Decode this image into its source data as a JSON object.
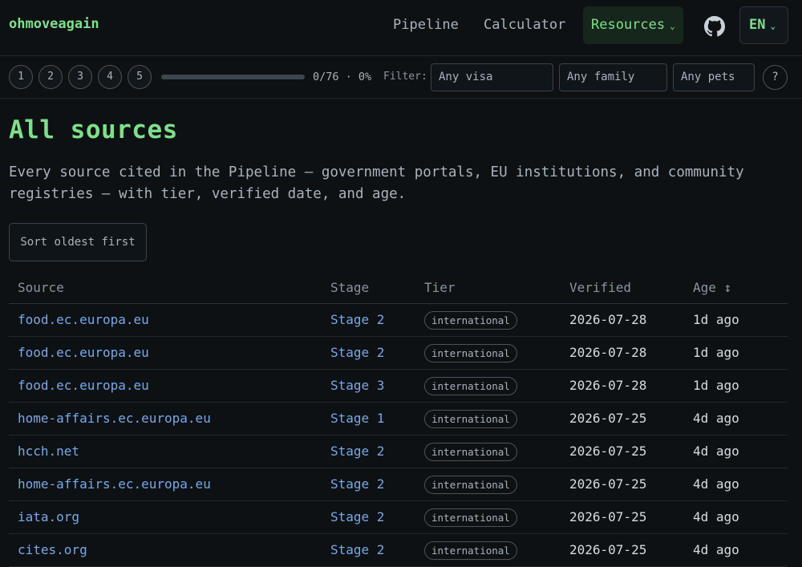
{
  "brand": "ohmoveagain",
  "nav": {
    "pipeline": "Pipeline",
    "calculator": "Calculator",
    "resources": "Resources",
    "caret": "⌄",
    "lang": "EN",
    "github_icon": "github-icon"
  },
  "toolbar": {
    "steps": [
      "1",
      "2",
      "3",
      "4",
      "5"
    ],
    "progress_fraction": 0,
    "progress_text": "0/76 · 0%",
    "filter_label": "Filter:",
    "visa_select": "Any visa",
    "family_select": "Any family",
    "pets_select": "Any pets",
    "help": "?"
  },
  "main": {
    "title": "All sources",
    "description": "Every source cited in the Pipeline — government portals, EU institutions, and community registries — with tier, verified date, and age.",
    "sort_button": "Sort oldest first"
  },
  "table": {
    "headers": {
      "source": "Source",
      "stage": "Stage",
      "tier": "Tier",
      "verified": "Verified",
      "age": "Age ↕"
    },
    "rows": [
      {
        "source": "food.ec.europa.eu",
        "stage": "Stage 2",
        "tier": "international",
        "verified": "2026-07-28",
        "age": "1d ago"
      },
      {
        "source": "food.ec.europa.eu",
        "stage": "Stage 2",
        "tier": "international",
        "verified": "2026-07-28",
        "age": "1d ago"
      },
      {
        "source": "food.ec.europa.eu",
        "stage": "Stage 3",
        "tier": "international",
        "verified": "2026-07-28",
        "age": "1d ago"
      },
      {
        "source": "home-affairs.ec.europa.eu",
        "stage": "Stage 1",
        "tier": "international",
        "verified": "2026-07-25",
        "age": "4d ago"
      },
      {
        "source": "hcch.net",
        "stage": "Stage 2",
        "tier": "international",
        "verified": "2026-07-25",
        "age": "4d ago"
      },
      {
        "source": "home-affairs.ec.europa.eu",
        "stage": "Stage 2",
        "tier": "international",
        "verified": "2026-07-25",
        "age": "4d ago"
      },
      {
        "source": "iata.org",
        "stage": "Stage 2",
        "tier": "international",
        "verified": "2026-07-25",
        "age": "4d ago"
      },
      {
        "source": "cites.org",
        "stage": "Stage 2",
        "tier": "international",
        "verified": "2026-07-25",
        "age": "4d ago"
      }
    ]
  },
  "colors": {
    "background": "#0d1114",
    "accent": "#7ee08a",
    "link": "#79a8e8"
  }
}
